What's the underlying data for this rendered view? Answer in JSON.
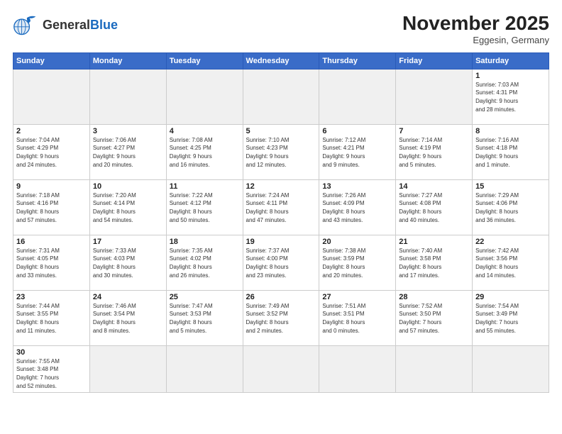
{
  "header": {
    "logo_general": "General",
    "logo_blue": "Blue",
    "month_title": "November 2025",
    "subtitle": "Eggesin, Germany"
  },
  "weekdays": [
    "Sunday",
    "Monday",
    "Tuesday",
    "Wednesday",
    "Thursday",
    "Friday",
    "Saturday"
  ],
  "weeks": [
    [
      {
        "day": "",
        "info": "",
        "empty": true
      },
      {
        "day": "",
        "info": "",
        "empty": true
      },
      {
        "day": "",
        "info": "",
        "empty": true
      },
      {
        "day": "",
        "info": "",
        "empty": true
      },
      {
        "day": "",
        "info": "",
        "empty": true
      },
      {
        "day": "",
        "info": "",
        "empty": true
      },
      {
        "day": "1",
        "info": "Sunrise: 7:03 AM\nSunset: 4:31 PM\nDaylight: 9 hours\nand 28 minutes.",
        "empty": false
      }
    ],
    [
      {
        "day": "2",
        "info": "Sunrise: 7:04 AM\nSunset: 4:29 PM\nDaylight: 9 hours\nand 24 minutes.",
        "empty": false
      },
      {
        "day": "3",
        "info": "Sunrise: 7:06 AM\nSunset: 4:27 PM\nDaylight: 9 hours\nand 20 minutes.",
        "empty": false
      },
      {
        "day": "4",
        "info": "Sunrise: 7:08 AM\nSunset: 4:25 PM\nDaylight: 9 hours\nand 16 minutes.",
        "empty": false
      },
      {
        "day": "5",
        "info": "Sunrise: 7:10 AM\nSunset: 4:23 PM\nDaylight: 9 hours\nand 12 minutes.",
        "empty": false
      },
      {
        "day": "6",
        "info": "Sunrise: 7:12 AM\nSunset: 4:21 PM\nDaylight: 9 hours\nand 9 minutes.",
        "empty": false
      },
      {
        "day": "7",
        "info": "Sunrise: 7:14 AM\nSunset: 4:19 PM\nDaylight: 9 hours\nand 5 minutes.",
        "empty": false
      },
      {
        "day": "8",
        "info": "Sunrise: 7:16 AM\nSunset: 4:18 PM\nDaylight: 9 hours\nand 1 minute.",
        "empty": false
      }
    ],
    [
      {
        "day": "9",
        "info": "Sunrise: 7:18 AM\nSunset: 4:16 PM\nDaylight: 8 hours\nand 57 minutes.",
        "empty": false
      },
      {
        "day": "10",
        "info": "Sunrise: 7:20 AM\nSunset: 4:14 PM\nDaylight: 8 hours\nand 54 minutes.",
        "empty": false
      },
      {
        "day": "11",
        "info": "Sunrise: 7:22 AM\nSunset: 4:12 PM\nDaylight: 8 hours\nand 50 minutes.",
        "empty": false
      },
      {
        "day": "12",
        "info": "Sunrise: 7:24 AM\nSunset: 4:11 PM\nDaylight: 8 hours\nand 47 minutes.",
        "empty": false
      },
      {
        "day": "13",
        "info": "Sunrise: 7:26 AM\nSunset: 4:09 PM\nDaylight: 8 hours\nand 43 minutes.",
        "empty": false
      },
      {
        "day": "14",
        "info": "Sunrise: 7:27 AM\nSunset: 4:08 PM\nDaylight: 8 hours\nand 40 minutes.",
        "empty": false
      },
      {
        "day": "15",
        "info": "Sunrise: 7:29 AM\nSunset: 4:06 PM\nDaylight: 8 hours\nand 36 minutes.",
        "empty": false
      }
    ],
    [
      {
        "day": "16",
        "info": "Sunrise: 7:31 AM\nSunset: 4:05 PM\nDaylight: 8 hours\nand 33 minutes.",
        "empty": false
      },
      {
        "day": "17",
        "info": "Sunrise: 7:33 AM\nSunset: 4:03 PM\nDaylight: 8 hours\nand 30 minutes.",
        "empty": false
      },
      {
        "day": "18",
        "info": "Sunrise: 7:35 AM\nSunset: 4:02 PM\nDaylight: 8 hours\nand 26 minutes.",
        "empty": false
      },
      {
        "day": "19",
        "info": "Sunrise: 7:37 AM\nSunset: 4:00 PM\nDaylight: 8 hours\nand 23 minutes.",
        "empty": false
      },
      {
        "day": "20",
        "info": "Sunrise: 7:38 AM\nSunset: 3:59 PM\nDaylight: 8 hours\nand 20 minutes.",
        "empty": false
      },
      {
        "day": "21",
        "info": "Sunrise: 7:40 AM\nSunset: 3:58 PM\nDaylight: 8 hours\nand 17 minutes.",
        "empty": false
      },
      {
        "day": "22",
        "info": "Sunrise: 7:42 AM\nSunset: 3:56 PM\nDaylight: 8 hours\nand 14 minutes.",
        "empty": false
      }
    ],
    [
      {
        "day": "23",
        "info": "Sunrise: 7:44 AM\nSunset: 3:55 PM\nDaylight: 8 hours\nand 11 minutes.",
        "empty": false
      },
      {
        "day": "24",
        "info": "Sunrise: 7:46 AM\nSunset: 3:54 PM\nDaylight: 8 hours\nand 8 minutes.",
        "empty": false
      },
      {
        "day": "25",
        "info": "Sunrise: 7:47 AM\nSunset: 3:53 PM\nDaylight: 8 hours\nand 5 minutes.",
        "empty": false
      },
      {
        "day": "26",
        "info": "Sunrise: 7:49 AM\nSunset: 3:52 PM\nDaylight: 8 hours\nand 2 minutes.",
        "empty": false
      },
      {
        "day": "27",
        "info": "Sunrise: 7:51 AM\nSunset: 3:51 PM\nDaylight: 8 hours\nand 0 minutes.",
        "empty": false
      },
      {
        "day": "28",
        "info": "Sunrise: 7:52 AM\nSunset: 3:50 PM\nDaylight: 7 hours\nand 57 minutes.",
        "empty": false
      },
      {
        "day": "29",
        "info": "Sunrise: 7:54 AM\nSunset: 3:49 PM\nDaylight: 7 hours\nand 55 minutes.",
        "empty": false
      }
    ],
    [
      {
        "day": "30",
        "info": "Sunrise: 7:55 AM\nSunset: 3:48 PM\nDaylight: 7 hours\nand 52 minutes.",
        "empty": false,
        "last": true
      },
      {
        "day": "",
        "info": "",
        "empty": true,
        "last": true
      },
      {
        "day": "",
        "info": "",
        "empty": true,
        "last": true
      },
      {
        "day": "",
        "info": "",
        "empty": true,
        "last": true
      },
      {
        "day": "",
        "info": "",
        "empty": true,
        "last": true
      },
      {
        "day": "",
        "info": "",
        "empty": true,
        "last": true
      },
      {
        "day": "",
        "info": "",
        "empty": true,
        "last": true
      }
    ]
  ]
}
